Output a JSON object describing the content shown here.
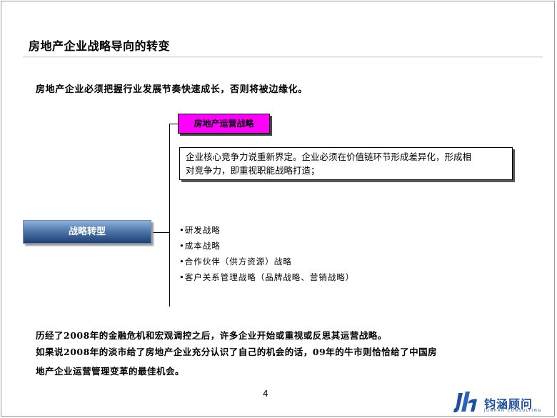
{
  "page": {
    "title": "房地产企业战略导向的转变",
    "intro": "房地产企业必须把握行业发展节奏快速成长，否则将被边缘化。"
  },
  "diagram": {
    "top_node": "房地产运营战略",
    "description_lines": [
      "企业核心竞争力说重新界定。企业必须在价值链环节形成差异化，形成相",
      "对竞争力，即重视职能战略打造；"
    ],
    "root_node": "战略转型",
    "bullets": [
      "•研发战略",
      "•成本战略",
      "•合作伙伴（供方资源）战略",
      "•客户关系管理战略（品牌战略、营销战略）"
    ]
  },
  "summary": [
    "历经了2008年的金融危机和宏观调控之后，许多企业开始或重视或反思其运营战略。",
    "如果说2008年的淡市给了房地产企业充分认识了自己的机会的话，09年的牛市则恰恰给了中国房",
    "地产企业运营管理变革的最佳机会。"
  ],
  "footer": {
    "page_number": "4",
    "logo_text": "钧涵顾问",
    "logo_subtext": "JUNHAN CONSULTING"
  },
  "colors": {
    "top_node_fill": "#ff00ff",
    "root_node_fill": "#3a5f94",
    "logo_blue": "#1f4fa0"
  }
}
